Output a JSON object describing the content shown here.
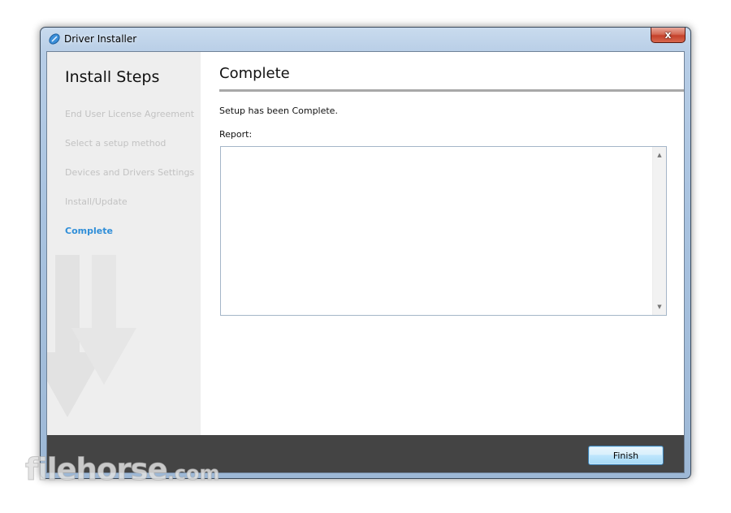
{
  "window": {
    "title": "Driver Installer",
    "close_label": "x"
  },
  "sidebar": {
    "title": "Install Steps",
    "steps": [
      {
        "label": "End User License Agreement",
        "state": "done"
      },
      {
        "label": "Select a setup method",
        "state": "done"
      },
      {
        "label": "Devices and Drivers Settings",
        "state": "done"
      },
      {
        "label": "Install/Update",
        "state": "done"
      },
      {
        "label": "Complete",
        "state": "active"
      }
    ]
  },
  "main": {
    "title": "Complete",
    "status_text": "Setup has been Complete.",
    "report_label": "Report:",
    "report_text": ""
  },
  "footer": {
    "finish_label": "Finish"
  },
  "watermark": {
    "text": "filehorse",
    "suffix": ".com"
  },
  "colors": {
    "active_step": "#2f8ed8",
    "inactive_step": "#c2c2c2",
    "footer_bg": "#444444",
    "sidebar_bg": "#eeeeee"
  }
}
